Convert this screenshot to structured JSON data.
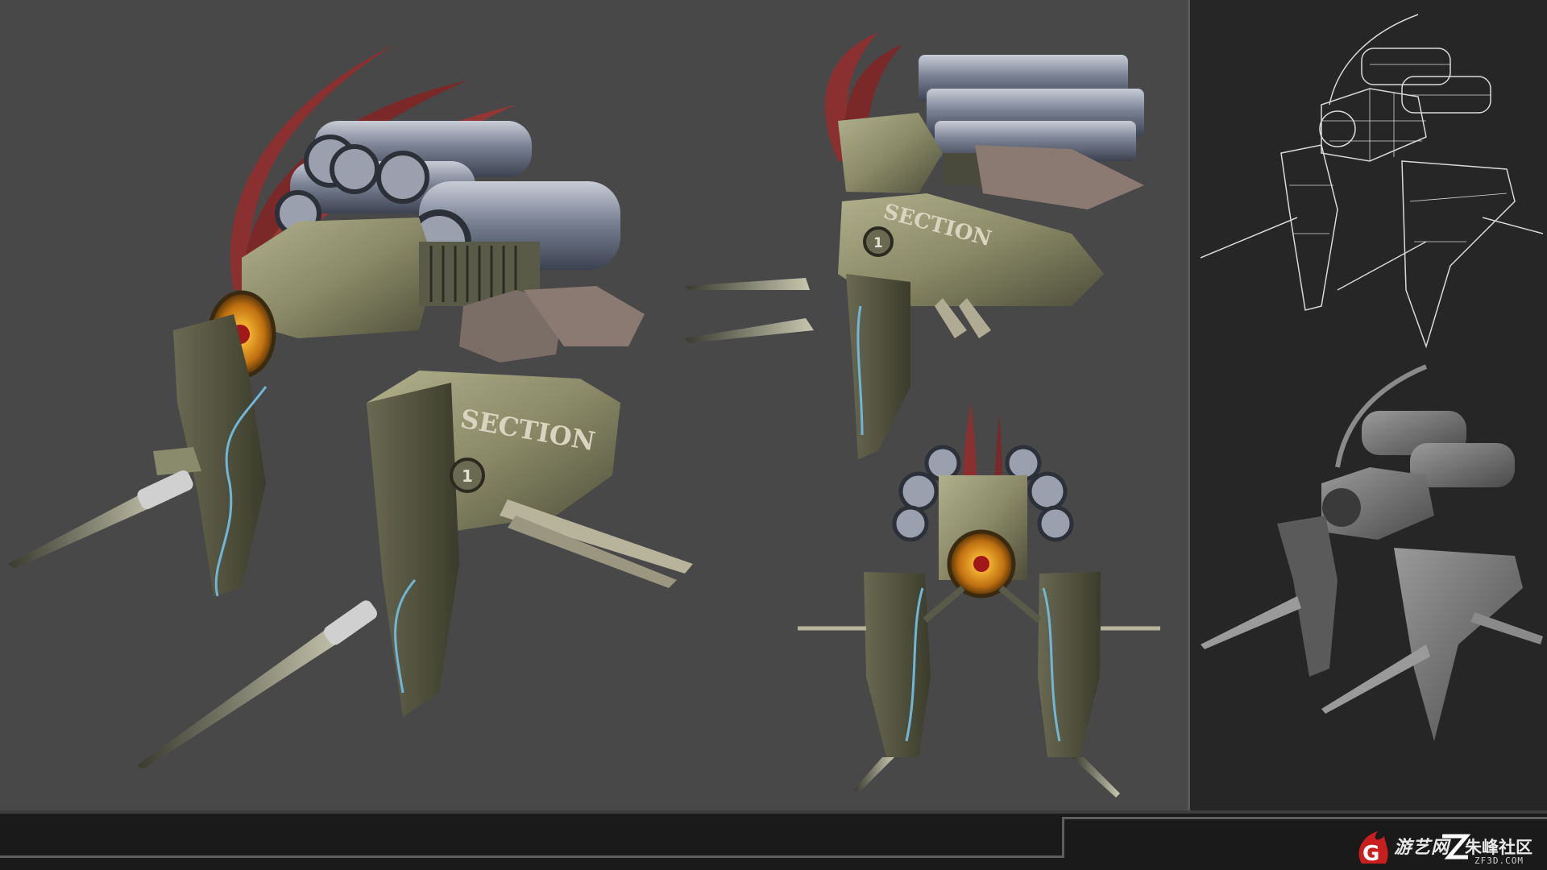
{
  "labels": {
    "decal_text": "SECTION",
    "hatch_number": "1"
  },
  "watermark": {
    "brand_cn": "游艺网",
    "community_cn": "朱峰社区",
    "domain": "ZF3D.COM"
  },
  "colors": {
    "background": "#484848",
    "side_panel": "#262626",
    "armor": "#8a8a6a",
    "engine": "#6b7384",
    "eye": "#e0a020",
    "tendril": "#8a3030",
    "cable": "#6fb6d8",
    "wireframe": "#d8d8d8",
    "clay": "#7a7a7a"
  },
  "icons": [
    "g-flame-logo-icon",
    "z-logo-icon"
  ]
}
